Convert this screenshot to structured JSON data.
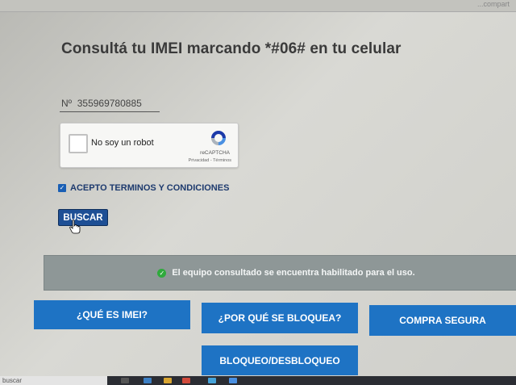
{
  "top_bar": {
    "subtext": "...compart"
  },
  "page": {
    "title": "Consultá tu IMEI marcando *#06# en tu celular"
  },
  "imei": {
    "value": "Nº  355969780885"
  },
  "captcha": {
    "label": "No soy un robot",
    "brand": "reCAPTCHA",
    "links": "Privacidad - Términos"
  },
  "terms": {
    "label": "ACEPTO TERMINOS Y CONDICIONES",
    "checked": true
  },
  "search_button": {
    "label": "BUSCAR"
  },
  "status": {
    "message": "El equipo consultado se encuentra habilitado para el uso.",
    "icon": "check-circle-icon",
    "color": "#2faa3c"
  },
  "nav": {
    "what_is_imei": "¿QUÉ ES IMEI?",
    "why_blocked": "¿POR QUÉ SE BLOQUEA?",
    "secure_purchase": "COMPRA SEGURA",
    "block_unblock": "BLOQUEO/DESBLOQUEO"
  },
  "taskbar": {
    "search_text": "buscar"
  },
  "colors": {
    "primary_button": "#1e73c4",
    "search_button": "#1e4f95",
    "status_bg": "#8e9797"
  }
}
